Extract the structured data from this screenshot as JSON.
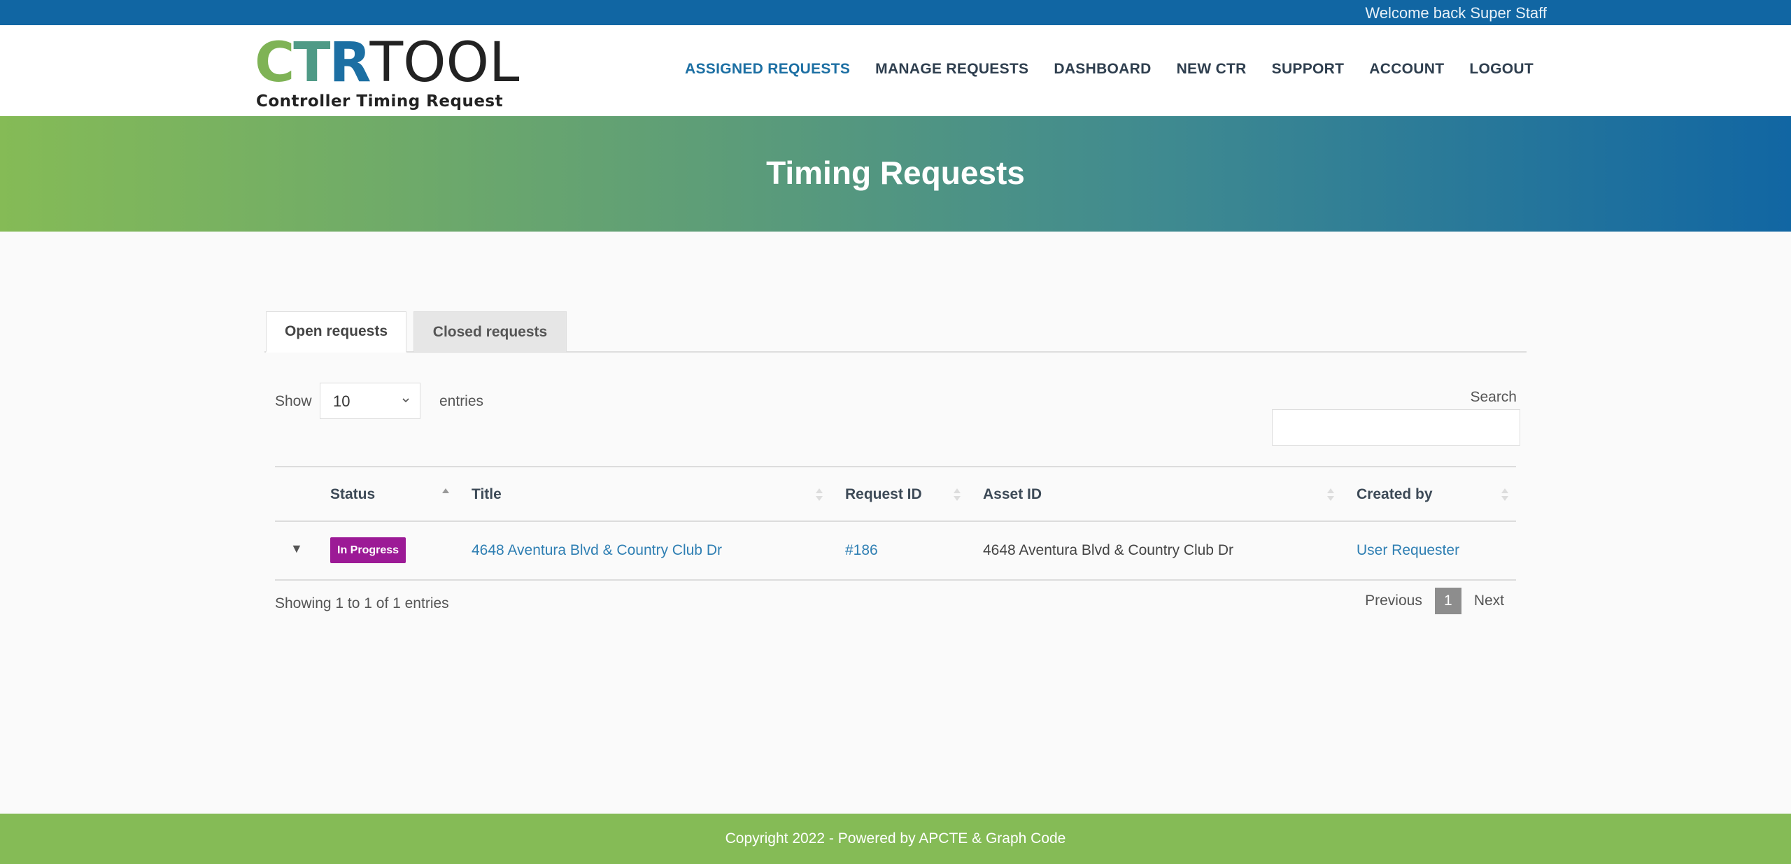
{
  "topbar": {
    "welcome": "Welcome back Super Staff"
  },
  "logo": {
    "c": "C",
    "t": "T",
    "r": "R",
    "tool": "TOOL",
    "subtitle": "Controller Timing Request"
  },
  "nav": {
    "items": [
      {
        "label": "ASSIGNED REQUESTS",
        "active": true
      },
      {
        "label": "MANAGE REQUESTS"
      },
      {
        "label": "DASHBOARD"
      },
      {
        "label": "NEW CTR"
      },
      {
        "label": "SUPPORT"
      },
      {
        "label": "ACCOUNT"
      },
      {
        "label": "LOGOUT"
      }
    ]
  },
  "hero": {
    "title": "Timing Requests"
  },
  "tabs": [
    {
      "label": "Open requests",
      "active": true
    },
    {
      "label": "Closed requests"
    }
  ],
  "length_control": {
    "show_label": "Show",
    "value": "10",
    "entries_label": "entries"
  },
  "search": {
    "label": "Search",
    "value": ""
  },
  "table": {
    "columns": [
      "Status",
      "Title",
      "Request ID",
      "Asset ID",
      "Created by"
    ],
    "rows": [
      {
        "expander": "▼",
        "status": "In Progress",
        "title": "4648 Aventura Blvd & Country Club Dr",
        "request_id": "#186",
        "asset_id": "4648 Aventura Blvd & Country Club Dr",
        "created_by": "User Requester"
      }
    ]
  },
  "table_info": "Showing 1 to 1 of 1 entries",
  "pagination": {
    "previous": "Previous",
    "current": "1",
    "next": "Next"
  },
  "footer": {
    "text": "Copyright 2022 - Powered by APCTE & Graph Code"
  },
  "colors": {
    "topbar": "#1166a3",
    "brand_green": "#85bb56",
    "brand_blue": "#1c6fa3",
    "badge_in_progress": "#9c1a96",
    "link": "#2f7fb3"
  }
}
